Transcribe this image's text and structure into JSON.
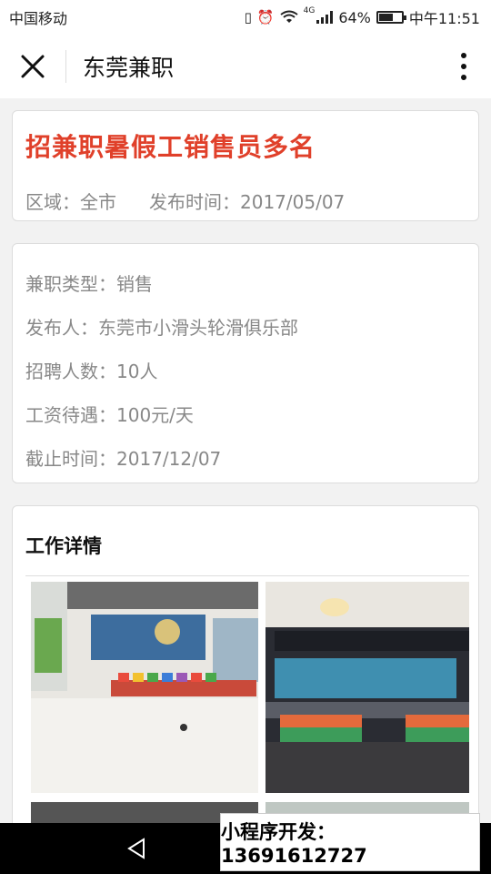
{
  "status_bar": {
    "carrier": "中国移动",
    "network": "4G",
    "battery": "64%",
    "battery_level": 0.64,
    "time": "中午11:51"
  },
  "app_bar": {
    "title": "东莞兼职",
    "close_icon": "close-icon",
    "more_icon": "more-vertical-icon"
  },
  "job": {
    "title": "招兼职暑假工销售员多名",
    "area": "区域：全市",
    "published": "发布时间：2017/05/07"
  },
  "details": [
    "兼职类型：销售",
    "发布人：东莞市小滑头轮滑俱乐部",
    "招聘人数：10人",
    "工资待遇：100元/天",
    "截止时间：2017/12/07"
  ],
  "work_details": {
    "title": "工作详情"
  },
  "promo": "小程序开发：13691612727",
  "colors": {
    "title_red": "#e0402a",
    "muted_text": "#888888",
    "background": "#f2f2f2"
  }
}
